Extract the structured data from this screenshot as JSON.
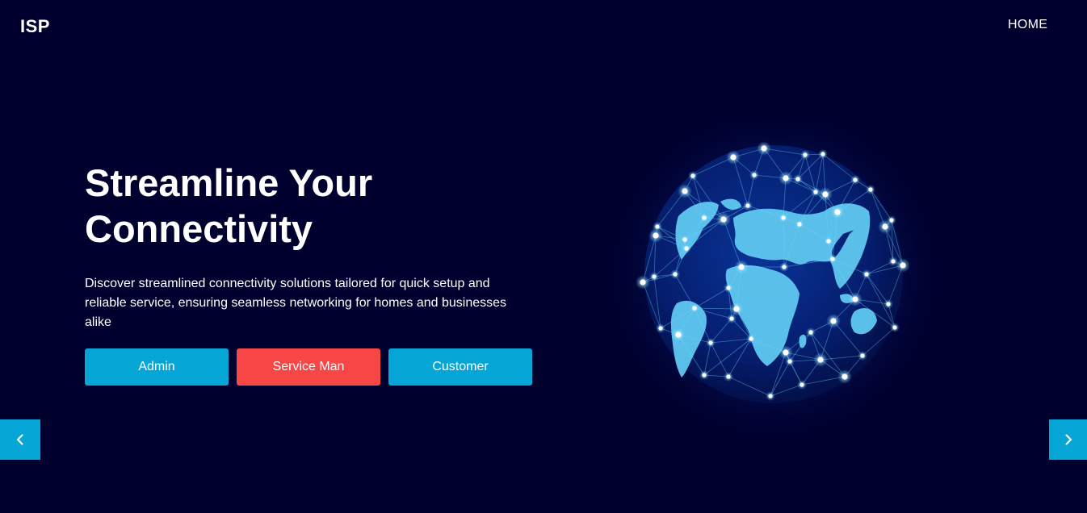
{
  "header": {
    "brand": "ISP",
    "nav": {
      "home": "HOME"
    }
  },
  "hero": {
    "title": "Streamline Your Connectivity",
    "description": "Discover streamlined connectivity solutions tailored for quick setup and reliable service, ensuring seamless networking for homes and businesses alike"
  },
  "buttons": {
    "admin": "Admin",
    "service_man": "Service Man",
    "customer": "Customer"
  },
  "carousel": {
    "prev_icon": "chevron-left-icon",
    "next_icon": "chevron-right-icon"
  },
  "colors": {
    "background": "#00002e",
    "accent_blue": "#05a6d6",
    "accent_red": "#f64646",
    "globe_land": "#5fc8f0"
  }
}
